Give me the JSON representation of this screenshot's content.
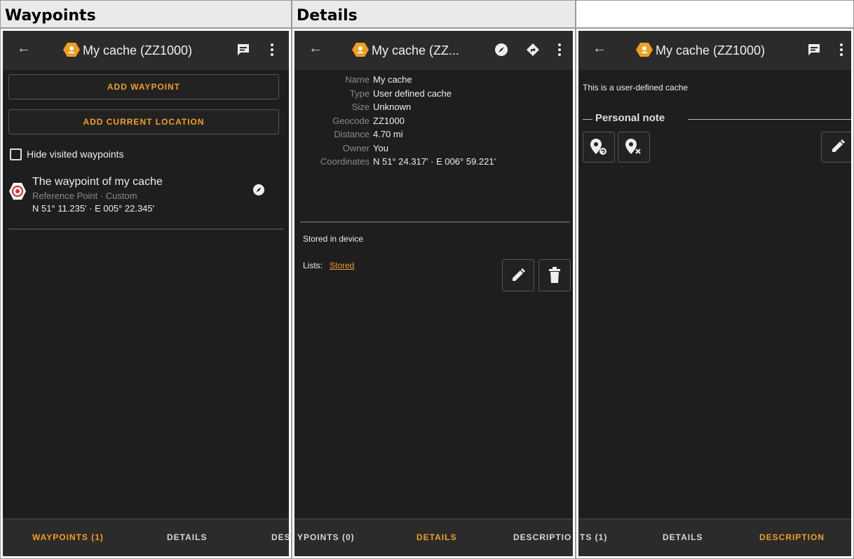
{
  "headers": {
    "col1": "Waypoints",
    "col2": "Details",
    "col3": ""
  },
  "app": {
    "cache_title_full": "My cache (ZZ1000)",
    "cache_title_truncated": "My cache (ZZ..."
  },
  "waypoints_screen": {
    "add_waypoint": "ADD WAYPOINT",
    "add_current_location": "ADD CURRENT LOCATION",
    "hide_visited": "Hide visited waypoints",
    "waypoint": {
      "name": "The waypoint of my cache",
      "subtitle": "Reference Point · Custom",
      "coords": "N 51° 11.235' · E 005° 22.345'"
    },
    "tabs": [
      "WAYPOINTS (1)",
      "DETAILS",
      "DES"
    ]
  },
  "details_screen": {
    "rows": [
      {
        "key": "Name",
        "value": "My cache"
      },
      {
        "key": "Type",
        "value": "User defined cache"
      },
      {
        "key": "Size",
        "value": "Unknown"
      },
      {
        "key": "Geocode",
        "value": "ZZ1000"
      },
      {
        "key": "Distance",
        "value": "4.70 mi"
      },
      {
        "key": "Owner",
        "value": "You"
      },
      {
        "key": "Coordinates",
        "value": "N 51° 24.317' · E 006° 59.221'"
      }
    ],
    "stored": "Stored in device",
    "lists_label": "Lists:",
    "lists_value": "Stored",
    "tabs": [
      "YPOINTS (0)",
      "DETAILS",
      "DESCRIPTIO"
    ]
  },
  "description_screen": {
    "text": "This is a user-defined cache",
    "personal_note": "Personal note",
    "tabs": [
      "TS (1)",
      "DETAILS",
      "DESCRIPTION"
    ]
  },
  "colors": {
    "accent": "#f0a020",
    "bg": "#1e1e1e",
    "bar": "#2b2b2b"
  }
}
